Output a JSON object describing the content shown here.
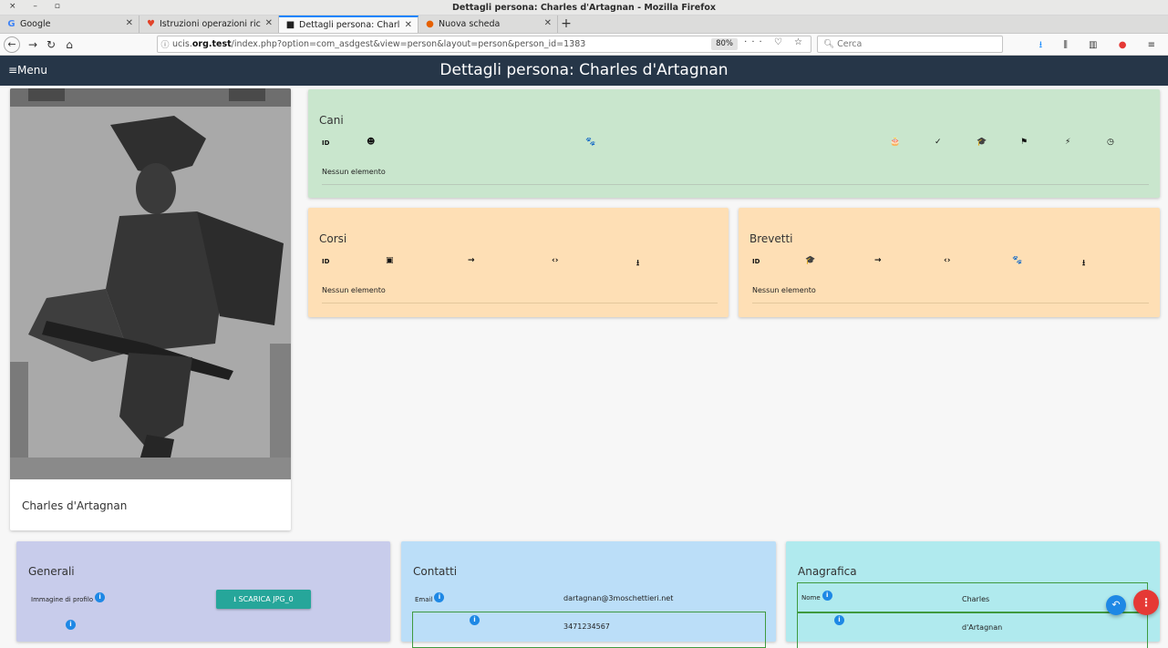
{
  "window": {
    "controls": "× – ▫",
    "title": "Dettagli persona: Charles d'Artagnan - Mozilla Firefox"
  },
  "tabs": [
    {
      "label": "Google",
      "icon": "G"
    },
    {
      "label": "Istruzioni operazioni ric",
      "icon": "♥"
    },
    {
      "label": "Dettagli persona: Charl",
      "icon": "■"
    },
    {
      "label": "Nuova scheda",
      "icon": "●"
    }
  ],
  "nav": {
    "url_prefix": "ucis.",
    "url_host": "org.test",
    "url_rest": "/index.php?option=com_asdgest&view=person&layout=person&person_id=1383",
    "zoom": "80%",
    "search_placeholder": "Cerca"
  },
  "app": {
    "menu_label": "≡Menu",
    "page_title": "Dettagli persona: Charles d'Artagnan"
  },
  "person": {
    "name": "Charles d'Artagnan"
  },
  "cani": {
    "title": "Cani",
    "columns": [
      {
        "label": "ID",
        "icon": "id-label"
      },
      {
        "label": "☻",
        "icon": "face-icon"
      },
      {
        "label": "🐾",
        "icon": "paw-icon"
      },
      {
        "label": "🎂",
        "icon": "cake-icon"
      },
      {
        "label": "✓",
        "icon": "check-icon"
      },
      {
        "label": "🎓",
        "icon": "graduation-icon"
      },
      {
        "label": "⚑",
        "icon": "bell-icon"
      },
      {
        "label": "⚡",
        "icon": "flash-icon"
      },
      {
        "label": "◷",
        "icon": "clock-icon"
      }
    ],
    "empty": "Nessun elemento"
  },
  "corsi": {
    "title": "Corsi",
    "columns": [
      {
        "label": "ID"
      },
      {
        "label": "▣"
      },
      {
        "label": "→"
      },
      {
        "label": "‹›"
      },
      {
        "label": "⭳"
      }
    ],
    "empty": "Nessun elemento"
  },
  "brevetti": {
    "title": "Brevetti",
    "columns": [
      {
        "label": "ID"
      },
      {
        "label": "🎓"
      },
      {
        "label": "→"
      },
      {
        "label": "‹›"
      },
      {
        "label": "🐾"
      },
      {
        "label": "⭳"
      }
    ],
    "empty": "Nessun elemento"
  },
  "generali": {
    "title": "Generali",
    "profile_label": "Immagine di profilo",
    "download_button": "⭳ SCARICA JPG_0"
  },
  "contatti": {
    "title": "Contatti",
    "email_label": "Email",
    "email_value": "dartagnan@3moschettieri.net",
    "phone_value": "3471234567"
  },
  "anagrafica": {
    "title": "Anagrafica",
    "nome_label": "Nome",
    "nome_value": "Charles",
    "cognome_value": "d'Artagnan"
  },
  "colors": {
    "appbar": "#263648",
    "cani_bg": "#c9e6cd",
    "corsi_bg": "#fedfb5",
    "generali_bg": "#c8cceb",
    "contatti_bg": "#bbdef8",
    "anagrafica_bg": "#b0eaee",
    "download_button": "#26a69a",
    "fab_more": "#e53935",
    "fab_undo": "#1e88e5"
  }
}
